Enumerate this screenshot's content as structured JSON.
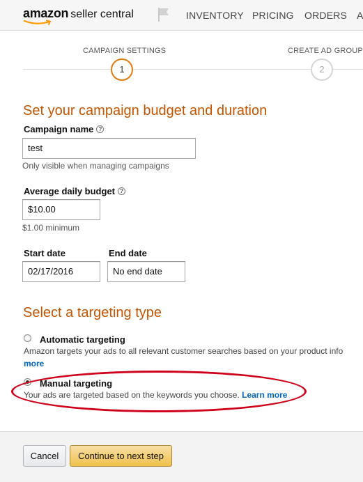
{
  "header": {
    "logo_brand": "amazon",
    "logo_product": "seller central",
    "nav": [
      "INVENTORY",
      "PRICING",
      "ORDERS",
      "A"
    ]
  },
  "stepper": {
    "steps": [
      {
        "label": "CAMPAIGN SETTINGS",
        "number": "1",
        "state": "active"
      },
      {
        "label": "CREATE AD GROUP",
        "number": "2",
        "state": "inactive"
      }
    ]
  },
  "budget_section": {
    "heading": "Set your campaign budget and duration",
    "campaign_name": {
      "label": "Campaign name",
      "value": "test",
      "hint": "Only visible when managing campaigns"
    },
    "daily_budget": {
      "label": "Average daily budget",
      "value": "$10.00",
      "hint": "$1.00 minimum"
    },
    "start_date": {
      "label": "Start date",
      "value": "02/17/2016"
    },
    "end_date": {
      "label": "End date",
      "value": "No end date"
    }
  },
  "targeting_section": {
    "heading": "Select a targeting type",
    "options": [
      {
        "title": "Automatic targeting",
        "description": "Amazon targets your ads to all relevant customer searches based on your product info",
        "link": "more",
        "selected": false
      },
      {
        "title": "Manual targeting",
        "description": "Your ads are targeted based on the keywords you choose.",
        "link": "Learn more",
        "selected": true
      }
    ]
  },
  "footer": {
    "cancel_label": "Cancel",
    "continue_label": "Continue to next step"
  },
  "colors": {
    "accent_orange": "#c45500",
    "step_active": "#e47911",
    "link_blue": "#0066c0",
    "annotation_red": "#d0021b",
    "primary_button": "#f0c14b"
  },
  "icons": [
    "amazon-smile-logo",
    "flag-icon",
    "help-icon"
  ]
}
